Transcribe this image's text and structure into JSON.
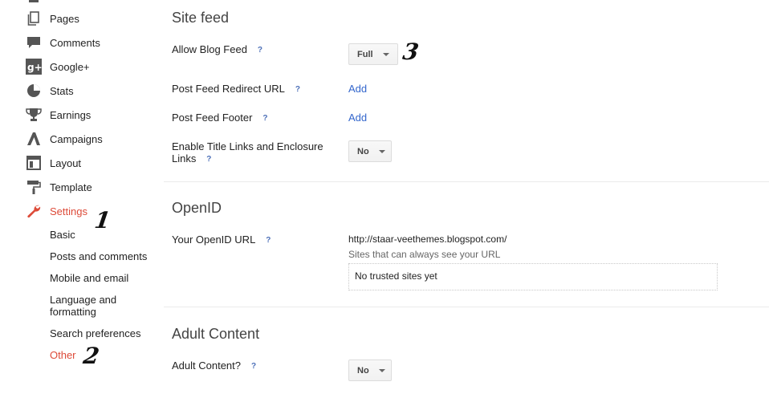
{
  "sidebar": {
    "items": [
      {
        "label": "Pages",
        "icon": "pages-icon"
      },
      {
        "label": "Comments",
        "icon": "comments-icon"
      },
      {
        "label": "Google+",
        "icon": "google-plus-icon"
      },
      {
        "label": "Stats",
        "icon": "stats-icon"
      },
      {
        "label": "Earnings",
        "icon": "earnings-icon"
      },
      {
        "label": "Campaigns",
        "icon": "campaigns-icon"
      },
      {
        "label": "Layout",
        "icon": "layout-icon"
      },
      {
        "label": "Template",
        "icon": "template-icon"
      },
      {
        "label": "Settings",
        "icon": "wrench-icon"
      }
    ],
    "settings_subitems": [
      {
        "label": "Basic"
      },
      {
        "label": "Posts and comments"
      },
      {
        "label": "Mobile and email"
      },
      {
        "label": "Language and formatting"
      },
      {
        "label": "Search preferences"
      },
      {
        "label": "Other"
      }
    ],
    "active_color": "#dd4b39"
  },
  "annotations": [
    "1",
    "2",
    "3"
  ],
  "site_feed": {
    "title": "Site feed",
    "allow_blog_feed": {
      "label": "Allow Blog Feed",
      "help": "?",
      "value": "Full"
    },
    "post_feed_redirect": {
      "label": "Post Feed Redirect URL",
      "help": "?",
      "action": "Add"
    },
    "post_feed_footer": {
      "label": "Post Feed Footer",
      "help": "?",
      "action": "Add"
    },
    "title_links": {
      "label": "Enable Title Links and Enclosure Links",
      "help": "?",
      "value": "No"
    }
  },
  "openid": {
    "title": "OpenID",
    "your_url": {
      "label": "Your OpenID URL",
      "help": "?",
      "value": "http://staar-veethemes.blogspot.com/"
    },
    "trusted_hint": "Sites that can always see your URL",
    "trusted_empty": "No trusted sites yet"
  },
  "adult": {
    "title": "Adult Content",
    "adult_content": {
      "label": "Adult Content?",
      "help": "?",
      "value": "No"
    }
  },
  "link_color": "#3366cc"
}
